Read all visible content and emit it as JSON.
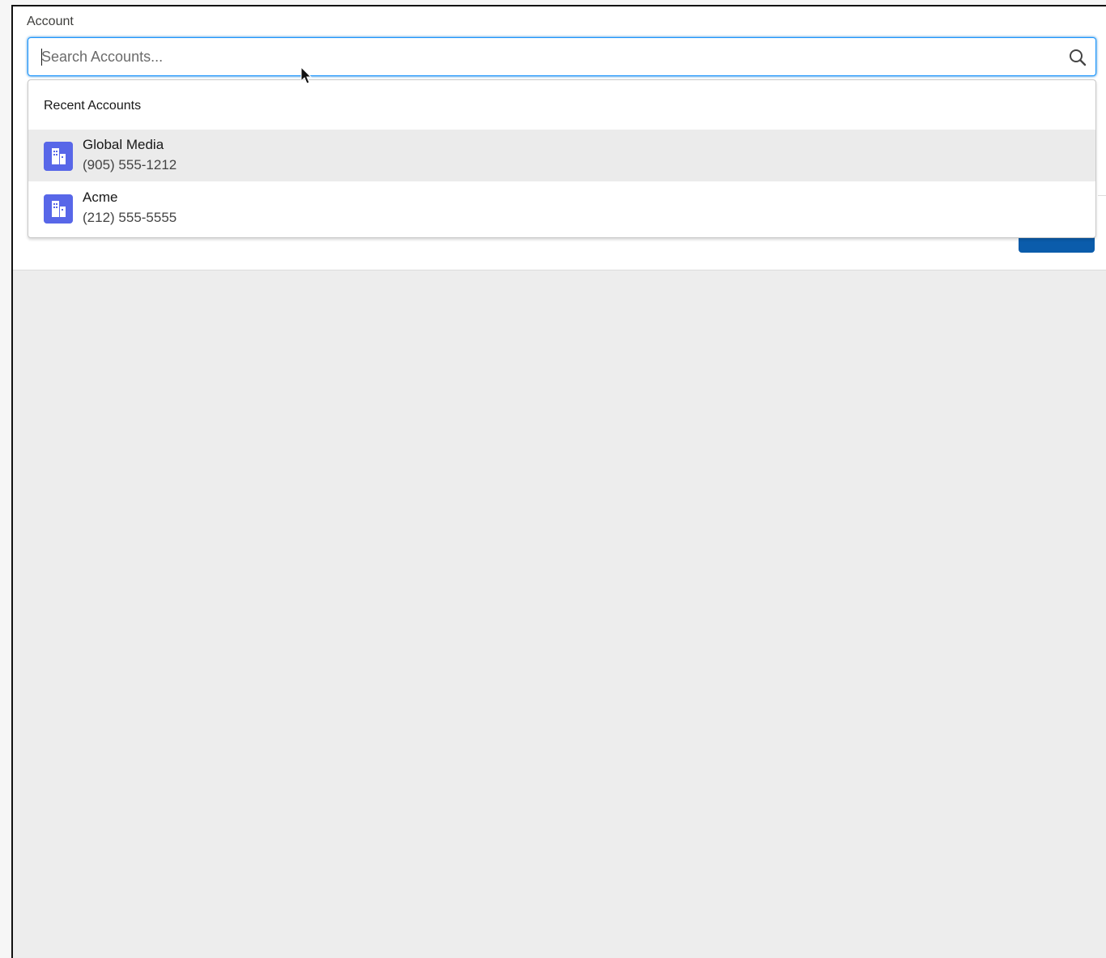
{
  "field": {
    "label": "Account",
    "search_placeholder": "Search Accounts..."
  },
  "dropdown": {
    "heading": "Recent Accounts",
    "items": [
      {
        "name": "Global Media",
        "phone": "(905) 555-1212",
        "icon": "account-icon",
        "hovered": true
      },
      {
        "name": "Acme",
        "phone": "(212) 555-5555",
        "icon": "account-icon",
        "hovered": false
      }
    ]
  },
  "footer": {
    "save_label": ""
  },
  "colors": {
    "focus_border": "#1b96ff",
    "account_icon": "#5867e8",
    "primary_button": "#0b5cab",
    "hover_row": "#ebebeb"
  }
}
